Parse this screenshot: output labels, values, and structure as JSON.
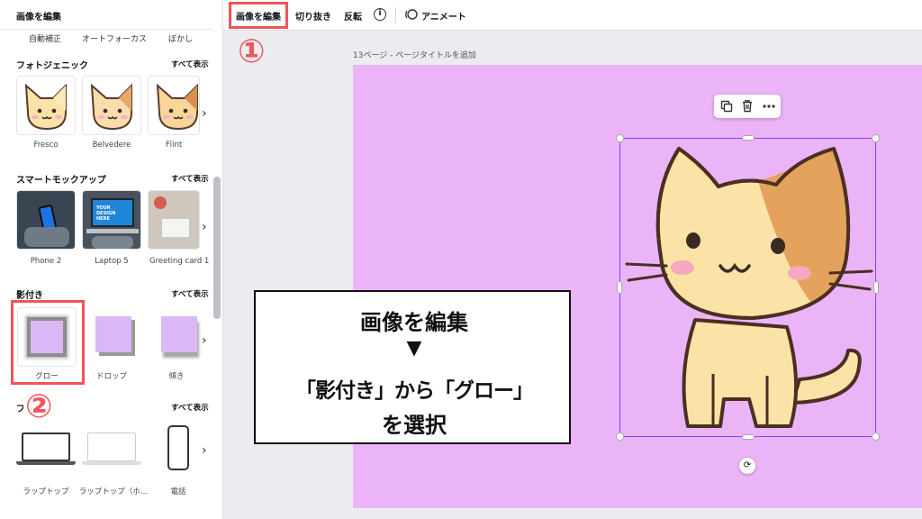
{
  "panel": {
    "title": "画像を編集",
    "adjust_tabs": [
      "自動補正",
      "オートフォーカス",
      "ぼかし"
    ],
    "sections": {
      "photogenic": {
        "title": "フォトジェニック",
        "see_all": "すべて表示",
        "items": [
          "Fresco",
          "Belvedere",
          "Flint"
        ]
      },
      "mockup": {
        "title": "スマートモックアップ",
        "see_all": "すべて表示",
        "items": [
          "Phone 2",
          "Laptop 5",
          "Greeting card 1"
        ],
        "laptop_screen_text": "YOUR DESIGN HERE"
      },
      "shadow": {
        "title": "影付き",
        "see_all": "すべて表示",
        "items": [
          "グロー",
          "ドロップ",
          "傾き"
        ]
      },
      "frame": {
        "title": "フレーム",
        "see_all": "すべて表示",
        "items": [
          "ラップトップ",
          "ラップトップ（ホ…",
          "電話"
        ]
      }
    }
  },
  "toolbar": {
    "edit_image": "画像を編集",
    "crop": "切り抜き",
    "flip": "反転",
    "info": "i",
    "animate": "アニメート"
  },
  "canvas": {
    "page_label": "13ページ - ページタイトルを追加"
  },
  "annotations": {
    "step1": "①",
    "step2": "②",
    "callout": {
      "line1": "画像を編集",
      "arrow": "▼",
      "line2": "「影付き」から「グロー」",
      "line3": "を選択"
    }
  },
  "colors": {
    "page_bg": "#ebb4f6",
    "accent_red": "#f0555a",
    "selection": "#8b3dff",
    "shadow_fill": "#d9b8f5"
  }
}
